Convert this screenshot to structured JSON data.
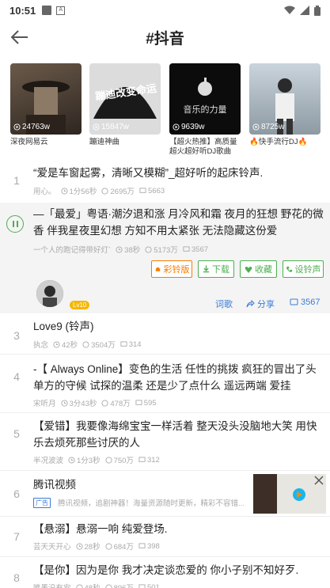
{
  "status_bar": {
    "time": "10:51"
  },
  "header": {
    "title": "#抖音"
  },
  "playlists": [
    {
      "name": "深夜网易云",
      "count": "24763w",
      "bg": "#4a3e34"
    },
    {
      "name": "蹦迪神曲",
      "count": "15847w",
      "bg": "#d6d6d6"
    },
    {
      "name": "【超火热推】高质量超火超好听DJ歌曲",
      "count": "9639w",
      "bg": "#0c0c0c"
    },
    {
      "name": "🔥快手流行DJ🔥",
      "count": "8725w",
      "bg": "#b8c4cc"
    }
  ],
  "cover_texts": {
    "pl2": "蹦迪改变命运",
    "pl3": "音乐的力量"
  },
  "songs": [
    {
      "idx": "1",
      "title": "“爱是车窗起雾，清晰又模糊”_超好听的起床铃声.",
      "artist": "用心。",
      "duration": "1分56秒",
      "plays": "2695万",
      "comments": "5663"
    },
    {
      "idx": "",
      "title": "—「最爱」粤语·潮汐退和涨 月冷风和霜 夜月的狂想 野花的微香 伴我星夜里幻想 方知不用太紧张 无法隐藏这份爱",
      "artist": "一个人的跑记得带好灯`",
      "duration": "38秒",
      "plays": "5173万",
      "comments": "3567"
    },
    {
      "idx": "3",
      "title": "Love9 (铃声)",
      "artist": "执念",
      "duration": "42秒",
      "plays": "3504万",
      "comments": "314"
    },
    {
      "idx": "4",
      "title": "-【 Always Online】变色的生活 任性的挑拨 疯狂的冒出了头 单方的守候 试探的温柔 还是少了点什么 遥远两端 爱挂",
      "artist": "宋听月",
      "duration": "3分43秒",
      "plays": "478万",
      "comments": "595"
    },
    {
      "idx": "5",
      "title": "【爱错】我要像海绵宝宝一样活着 整天没头没脑地大笑 用快乐去烦死那些讨厌的人",
      "artist": "半况波波",
      "duration": "1分3秒",
      "plays": "750万",
      "comments": "312"
    },
    {
      "idx": "7",
      "title": "【悬溺】悬溺一响 纯爱登场.",
      "artist": "芸天天开心",
      "duration": "28秒",
      "plays": "684万",
      "comments": "398"
    },
    {
      "idx": "8",
      "title": "【是你】因为是你 我才决定谈恋爱的 你小子别不知好歹.",
      "artist": "唯墨没有安",
      "duration": "48秒",
      "plays": "896万",
      "comments": "501"
    }
  ],
  "actions": {
    "ringtone": "彩铃版",
    "download": "下载",
    "favorite": "收藏",
    "set_ringtone": "设铃声",
    "lyrics": "词歌",
    "share": "分享",
    "comment_count": "3567",
    "level": "Lv10"
  },
  "ad": {
    "idx": "6",
    "title": "腾讯视频",
    "label": "广告",
    "desc": "腾讯视频，追剧神器！海量资源随时更新，精彩不容错..."
  },
  "colors": {
    "accent_green": "#4caf50",
    "ringtone_orange": "#f57c00",
    "link_blue": "#3a7bd5"
  }
}
